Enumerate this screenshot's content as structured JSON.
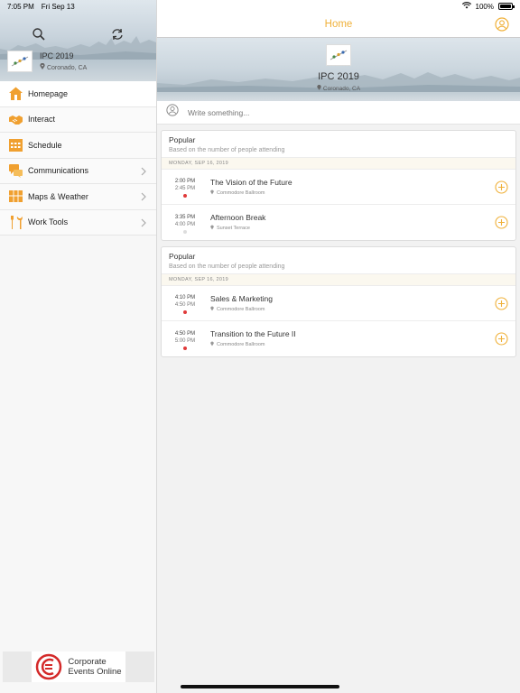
{
  "status_bar": {
    "time": "7:05 PM",
    "date": "Fri Sep 13",
    "battery": "100%"
  },
  "sidebar": {
    "event": {
      "title": "IPC 2019",
      "location": "Coronado, CA"
    },
    "items": [
      {
        "label": "Homepage",
        "icon": "home-icon"
      },
      {
        "label": "Interact",
        "icon": "handshake-icon"
      },
      {
        "label": "Schedule",
        "icon": "calendar-icon"
      },
      {
        "label": "Communications",
        "icon": "chat-icon"
      },
      {
        "label": "Maps & Weather",
        "icon": "map-icon"
      },
      {
        "label": "Work Tools",
        "icon": "tools-icon"
      }
    ],
    "footer": {
      "line1": "Corporate",
      "line2": "Events Online"
    }
  },
  "header": {
    "title": "Home"
  },
  "hero": {
    "title": "IPC 2019",
    "location": "Coronado, CA"
  },
  "compose": {
    "placeholder": "Write something..."
  },
  "cards": [
    {
      "title": "Popular",
      "subtitle": "Based on the number of people attending",
      "date": "MONDAY, SEP 16, 2019",
      "sessions": [
        {
          "start": "2:00 PM",
          "end": "2:45 PM",
          "title": "The Vision of the Future",
          "location": "Commodore Ballroom",
          "dot_color": "#e03a3a"
        },
        {
          "start": "3:35 PM",
          "end": "4:00 PM",
          "title": "Afternoon Break",
          "location": "Sunset Terrace",
          "dot_color": "#dddddd"
        }
      ]
    },
    {
      "title": "Popular",
      "subtitle": "Based on the number of people attending",
      "date": "MONDAY, SEP 16, 2019",
      "sessions": [
        {
          "start": "4:10 PM",
          "end": "4:50 PM",
          "title": "Sales & Marketing",
          "location": "Commodore Ballroom",
          "dot_color": "#e03a3a"
        },
        {
          "start": "4:50 PM",
          "end": "5:00 PM",
          "title": "Transition to the Future II",
          "location": "Commodore Ballroom",
          "dot_color": "#e03a3a"
        }
      ]
    }
  ],
  "colors": {
    "accent": "#f0b13a",
    "menu_icon": "#f0a030",
    "live_dot": "#e03a3a"
  }
}
